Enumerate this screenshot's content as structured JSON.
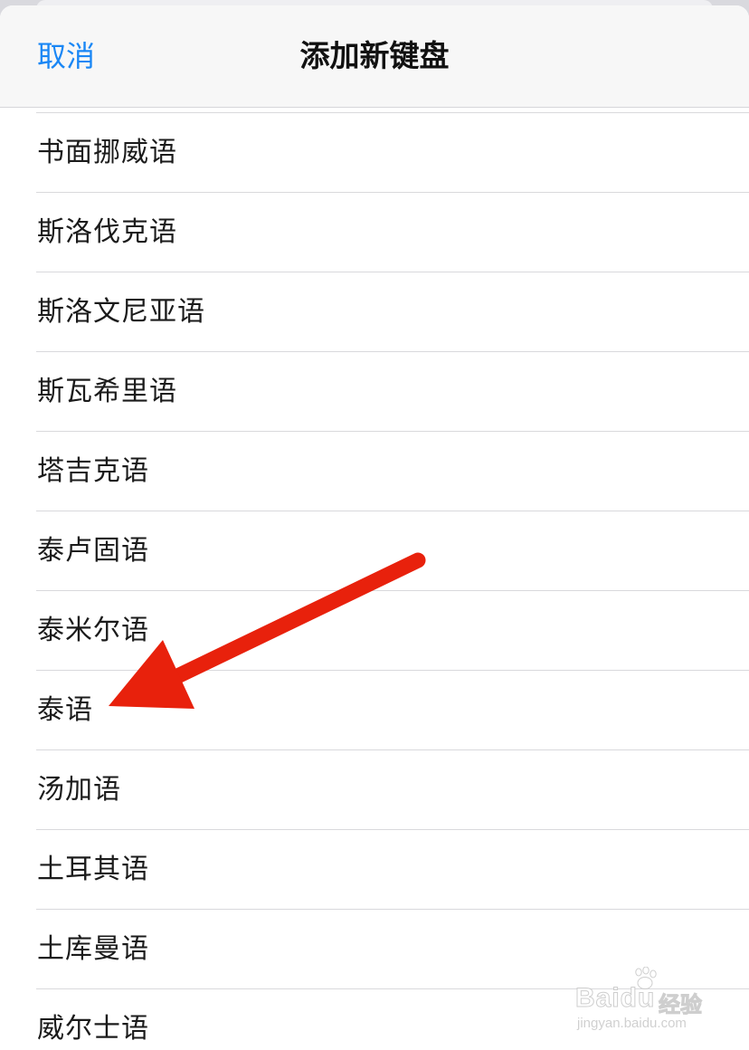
{
  "nav": {
    "cancel_label": "取消",
    "title": "添加新键盘"
  },
  "languages": [
    "书面挪威语",
    "斯洛伐克语",
    "斯洛文尼亚语",
    "斯瓦希里语",
    "塔吉克语",
    "泰卢固语",
    "泰米尔语",
    "泰语",
    "汤加语",
    "土耳其语",
    "土库曼语",
    "威尔士语"
  ],
  "annotation": {
    "arrow_color": "#e8210c",
    "target": "泰语"
  },
  "watermark": {
    "logo": "Baidu",
    "product": "经验",
    "url": "jingyan.baidu.com"
  },
  "colors": {
    "accent": "#1a87f5",
    "nav_background": "#f7f7f7",
    "divider": "#d9d9dc"
  }
}
